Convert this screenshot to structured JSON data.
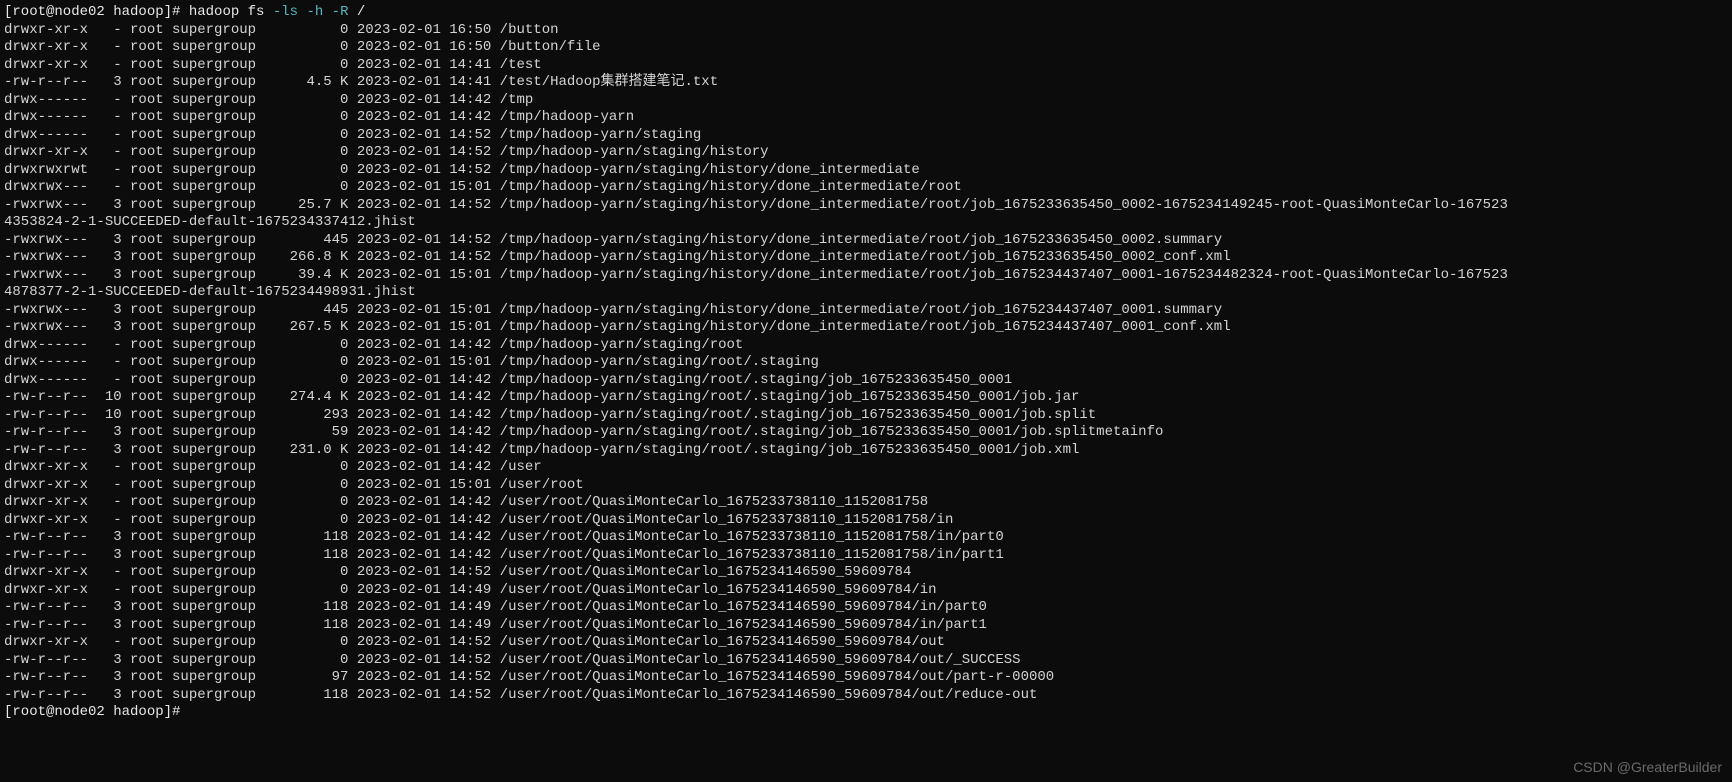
{
  "prompt": {
    "prefix": "[root@node02 hadoop]# ",
    "cmd_prefix": "hadoop fs ",
    "cmd_args": "-ls -h -R",
    "cmd_suffix": " /"
  },
  "listing": [
    {
      "perm": "drwxr-xr-x",
      "rep": "-",
      "user": "root",
      "group": "supergroup",
      "size": "0",
      "date": "2023-02-01",
      "time": "16:50",
      "path": "/button"
    },
    {
      "perm": "drwxr-xr-x",
      "rep": "-",
      "user": "root",
      "group": "supergroup",
      "size": "0",
      "date": "2023-02-01",
      "time": "16:50",
      "path": "/button/file"
    },
    {
      "perm": "drwxr-xr-x",
      "rep": "-",
      "user": "root",
      "group": "supergroup",
      "size": "0",
      "date": "2023-02-01",
      "time": "14:41",
      "path": "/test"
    },
    {
      "perm": "-rw-r--r--",
      "rep": "3",
      "user": "root",
      "group": "supergroup",
      "size": "4.5 K",
      "date": "2023-02-01",
      "time": "14:41",
      "path": "/test/Hadoop集群搭建笔记.txt"
    },
    {
      "perm": "drwx------",
      "rep": "-",
      "user": "root",
      "group": "supergroup",
      "size": "0",
      "date": "2023-02-01",
      "time": "14:42",
      "path": "/tmp"
    },
    {
      "perm": "drwx------",
      "rep": "-",
      "user": "root",
      "group": "supergroup",
      "size": "0",
      "date": "2023-02-01",
      "time": "14:42",
      "path": "/tmp/hadoop-yarn"
    },
    {
      "perm": "drwx------",
      "rep": "-",
      "user": "root",
      "group": "supergroup",
      "size": "0",
      "date": "2023-02-01",
      "time": "14:52",
      "path": "/tmp/hadoop-yarn/staging"
    },
    {
      "perm": "drwxr-xr-x",
      "rep": "-",
      "user": "root",
      "group": "supergroup",
      "size": "0",
      "date": "2023-02-01",
      "time": "14:52",
      "path": "/tmp/hadoop-yarn/staging/history"
    },
    {
      "perm": "drwxrwxrwt",
      "rep": "-",
      "user": "root",
      "group": "supergroup",
      "size": "0",
      "date": "2023-02-01",
      "time": "14:52",
      "path": "/tmp/hadoop-yarn/staging/history/done_intermediate"
    },
    {
      "perm": "drwxrwx---",
      "rep": "-",
      "user": "root",
      "group": "supergroup",
      "size": "0",
      "date": "2023-02-01",
      "time": "15:01",
      "path": "/tmp/hadoop-yarn/staging/history/done_intermediate/root"
    },
    {
      "perm": "-rwxrwx---",
      "rep": "3",
      "user": "root",
      "group": "supergroup",
      "size": "25.7 K",
      "date": "2023-02-01",
      "time": "14:52",
      "path": "/tmp/hadoop-yarn/staging/history/done_intermediate/root/job_1675233635450_0002-1675234149245-root-QuasiMonteCarlo-167523",
      "wrap": "4353824-2-1-SUCCEEDED-default-1675234337412.jhist"
    },
    {
      "perm": "-rwxrwx---",
      "rep": "3",
      "user": "root",
      "group": "supergroup",
      "size": "445",
      "date": "2023-02-01",
      "time": "14:52",
      "path": "/tmp/hadoop-yarn/staging/history/done_intermediate/root/job_1675233635450_0002.summary"
    },
    {
      "perm": "-rwxrwx---",
      "rep": "3",
      "user": "root",
      "group": "supergroup",
      "size": "266.8 K",
      "date": "2023-02-01",
      "time": "14:52",
      "path": "/tmp/hadoop-yarn/staging/history/done_intermediate/root/job_1675233635450_0002_conf.xml"
    },
    {
      "perm": "-rwxrwx---",
      "rep": "3",
      "user": "root",
      "group": "supergroup",
      "size": "39.4 K",
      "date": "2023-02-01",
      "time": "15:01",
      "path": "/tmp/hadoop-yarn/staging/history/done_intermediate/root/job_1675234437407_0001-1675234482324-root-QuasiMonteCarlo-167523",
      "wrap": "4878377-2-1-SUCCEEDED-default-1675234498931.jhist"
    },
    {
      "perm": "-rwxrwx---",
      "rep": "3",
      "user": "root",
      "group": "supergroup",
      "size": "445",
      "date": "2023-02-01",
      "time": "15:01",
      "path": "/tmp/hadoop-yarn/staging/history/done_intermediate/root/job_1675234437407_0001.summary"
    },
    {
      "perm": "-rwxrwx---",
      "rep": "3",
      "user": "root",
      "group": "supergroup",
      "size": "267.5 K",
      "date": "2023-02-01",
      "time": "15:01",
      "path": "/tmp/hadoop-yarn/staging/history/done_intermediate/root/job_1675234437407_0001_conf.xml"
    },
    {
      "perm": "drwx------",
      "rep": "-",
      "user": "root",
      "group": "supergroup",
      "size": "0",
      "date": "2023-02-01",
      "time": "14:42",
      "path": "/tmp/hadoop-yarn/staging/root"
    },
    {
      "perm": "drwx------",
      "rep": "-",
      "user": "root",
      "group": "supergroup",
      "size": "0",
      "date": "2023-02-01",
      "time": "15:01",
      "path": "/tmp/hadoop-yarn/staging/root/.staging"
    },
    {
      "perm": "drwx------",
      "rep": "-",
      "user": "root",
      "group": "supergroup",
      "size": "0",
      "date": "2023-02-01",
      "time": "14:42",
      "path": "/tmp/hadoop-yarn/staging/root/.staging/job_1675233635450_0001"
    },
    {
      "perm": "-rw-r--r--",
      "rep": "10",
      "user": "root",
      "group": "supergroup",
      "size": "274.4 K",
      "date": "2023-02-01",
      "time": "14:42",
      "path": "/tmp/hadoop-yarn/staging/root/.staging/job_1675233635450_0001/job.jar"
    },
    {
      "perm": "-rw-r--r--",
      "rep": "10",
      "user": "root",
      "group": "supergroup",
      "size": "293",
      "date": "2023-02-01",
      "time": "14:42",
      "path": "/tmp/hadoop-yarn/staging/root/.staging/job_1675233635450_0001/job.split"
    },
    {
      "perm": "-rw-r--r--",
      "rep": "3",
      "user": "root",
      "group": "supergroup",
      "size": "59",
      "date": "2023-02-01",
      "time": "14:42",
      "path": "/tmp/hadoop-yarn/staging/root/.staging/job_1675233635450_0001/job.splitmetainfo"
    },
    {
      "perm": "-rw-r--r--",
      "rep": "3",
      "user": "root",
      "group": "supergroup",
      "size": "231.0 K",
      "date": "2023-02-01",
      "time": "14:42",
      "path": "/tmp/hadoop-yarn/staging/root/.staging/job_1675233635450_0001/job.xml"
    },
    {
      "perm": "drwxr-xr-x",
      "rep": "-",
      "user": "root",
      "group": "supergroup",
      "size": "0",
      "date": "2023-02-01",
      "time": "14:42",
      "path": "/user"
    },
    {
      "perm": "drwxr-xr-x",
      "rep": "-",
      "user": "root",
      "group": "supergroup",
      "size": "0",
      "date": "2023-02-01",
      "time": "15:01",
      "path": "/user/root"
    },
    {
      "perm": "drwxr-xr-x",
      "rep": "-",
      "user": "root",
      "group": "supergroup",
      "size": "0",
      "date": "2023-02-01",
      "time": "14:42",
      "path": "/user/root/QuasiMonteCarlo_1675233738110_1152081758"
    },
    {
      "perm": "drwxr-xr-x",
      "rep": "-",
      "user": "root",
      "group": "supergroup",
      "size": "0",
      "date": "2023-02-01",
      "time": "14:42",
      "path": "/user/root/QuasiMonteCarlo_1675233738110_1152081758/in"
    },
    {
      "perm": "-rw-r--r--",
      "rep": "3",
      "user": "root",
      "group": "supergroup",
      "size": "118",
      "date": "2023-02-01",
      "time": "14:42",
      "path": "/user/root/QuasiMonteCarlo_1675233738110_1152081758/in/part0"
    },
    {
      "perm": "-rw-r--r--",
      "rep": "3",
      "user": "root",
      "group": "supergroup",
      "size": "118",
      "date": "2023-02-01",
      "time": "14:42",
      "path": "/user/root/QuasiMonteCarlo_1675233738110_1152081758/in/part1"
    },
    {
      "perm": "drwxr-xr-x",
      "rep": "-",
      "user": "root",
      "group": "supergroup",
      "size": "0",
      "date": "2023-02-01",
      "time": "14:52",
      "path": "/user/root/QuasiMonteCarlo_1675234146590_59609784"
    },
    {
      "perm": "drwxr-xr-x",
      "rep": "-",
      "user": "root",
      "group": "supergroup",
      "size": "0",
      "date": "2023-02-01",
      "time": "14:49",
      "path": "/user/root/QuasiMonteCarlo_1675234146590_59609784/in"
    },
    {
      "perm": "-rw-r--r--",
      "rep": "3",
      "user": "root",
      "group": "supergroup",
      "size": "118",
      "date": "2023-02-01",
      "time": "14:49",
      "path": "/user/root/QuasiMonteCarlo_1675234146590_59609784/in/part0"
    },
    {
      "perm": "-rw-r--r--",
      "rep": "3",
      "user": "root",
      "group": "supergroup",
      "size": "118",
      "date": "2023-02-01",
      "time": "14:49",
      "path": "/user/root/QuasiMonteCarlo_1675234146590_59609784/in/part1"
    },
    {
      "perm": "drwxr-xr-x",
      "rep": "-",
      "user": "root",
      "group": "supergroup",
      "size": "0",
      "date": "2023-02-01",
      "time": "14:52",
      "path": "/user/root/QuasiMonteCarlo_1675234146590_59609784/out"
    },
    {
      "perm": "-rw-r--r--",
      "rep": "3",
      "user": "root",
      "group": "supergroup",
      "size": "0",
      "date": "2023-02-01",
      "time": "14:52",
      "path": "/user/root/QuasiMonteCarlo_1675234146590_59609784/out/_SUCCESS"
    },
    {
      "perm": "-rw-r--r--",
      "rep": "3",
      "user": "root",
      "group": "supergroup",
      "size": "97",
      "date": "2023-02-01",
      "time": "14:52",
      "path": "/user/root/QuasiMonteCarlo_1675234146590_59609784/out/part-r-00000"
    },
    {
      "perm": "-rw-r--r--",
      "rep": "3",
      "user": "root",
      "group": "supergroup",
      "size": "118",
      "date": "2023-02-01",
      "time": "14:52",
      "path": "/user/root/QuasiMonteCarlo_1675234146590_59609784/out/reduce-out"
    }
  ],
  "prompt2": "[root@node02 hadoop]# ",
  "watermark": "CSDN @GreaterBuilder"
}
